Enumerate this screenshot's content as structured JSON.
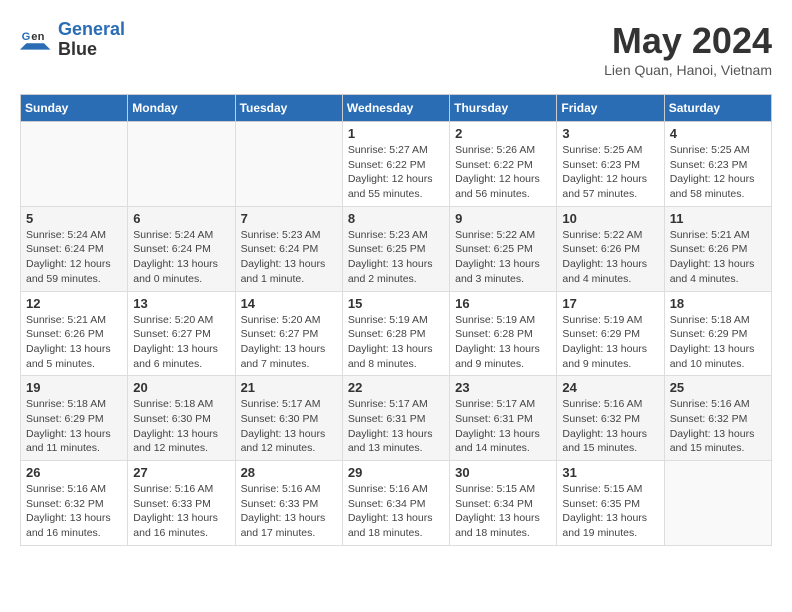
{
  "header": {
    "logo_line1": "General",
    "logo_line2": "Blue",
    "month_title": "May 2024",
    "location": "Lien Quan, Hanoi, Vietnam"
  },
  "days_of_week": [
    "Sunday",
    "Monday",
    "Tuesday",
    "Wednesday",
    "Thursday",
    "Friday",
    "Saturday"
  ],
  "weeks": [
    [
      {
        "day": "",
        "info": ""
      },
      {
        "day": "",
        "info": ""
      },
      {
        "day": "",
        "info": ""
      },
      {
        "day": "1",
        "info": "Sunrise: 5:27 AM\nSunset: 6:22 PM\nDaylight: 12 hours and 55 minutes."
      },
      {
        "day": "2",
        "info": "Sunrise: 5:26 AM\nSunset: 6:22 PM\nDaylight: 12 hours and 56 minutes."
      },
      {
        "day": "3",
        "info": "Sunrise: 5:25 AM\nSunset: 6:23 PM\nDaylight: 12 hours and 57 minutes."
      },
      {
        "day": "4",
        "info": "Sunrise: 5:25 AM\nSunset: 6:23 PM\nDaylight: 12 hours and 58 minutes."
      }
    ],
    [
      {
        "day": "5",
        "info": "Sunrise: 5:24 AM\nSunset: 6:24 PM\nDaylight: 12 hours and 59 minutes."
      },
      {
        "day": "6",
        "info": "Sunrise: 5:24 AM\nSunset: 6:24 PM\nDaylight: 13 hours and 0 minutes."
      },
      {
        "day": "7",
        "info": "Sunrise: 5:23 AM\nSunset: 6:24 PM\nDaylight: 13 hours and 1 minute."
      },
      {
        "day": "8",
        "info": "Sunrise: 5:23 AM\nSunset: 6:25 PM\nDaylight: 13 hours and 2 minutes."
      },
      {
        "day": "9",
        "info": "Sunrise: 5:22 AM\nSunset: 6:25 PM\nDaylight: 13 hours and 3 minutes."
      },
      {
        "day": "10",
        "info": "Sunrise: 5:22 AM\nSunset: 6:26 PM\nDaylight: 13 hours and 4 minutes."
      },
      {
        "day": "11",
        "info": "Sunrise: 5:21 AM\nSunset: 6:26 PM\nDaylight: 13 hours and 4 minutes."
      }
    ],
    [
      {
        "day": "12",
        "info": "Sunrise: 5:21 AM\nSunset: 6:26 PM\nDaylight: 13 hours and 5 minutes."
      },
      {
        "day": "13",
        "info": "Sunrise: 5:20 AM\nSunset: 6:27 PM\nDaylight: 13 hours and 6 minutes."
      },
      {
        "day": "14",
        "info": "Sunrise: 5:20 AM\nSunset: 6:27 PM\nDaylight: 13 hours and 7 minutes."
      },
      {
        "day": "15",
        "info": "Sunrise: 5:19 AM\nSunset: 6:28 PM\nDaylight: 13 hours and 8 minutes."
      },
      {
        "day": "16",
        "info": "Sunrise: 5:19 AM\nSunset: 6:28 PM\nDaylight: 13 hours and 9 minutes."
      },
      {
        "day": "17",
        "info": "Sunrise: 5:19 AM\nSunset: 6:29 PM\nDaylight: 13 hours and 9 minutes."
      },
      {
        "day": "18",
        "info": "Sunrise: 5:18 AM\nSunset: 6:29 PM\nDaylight: 13 hours and 10 minutes."
      }
    ],
    [
      {
        "day": "19",
        "info": "Sunrise: 5:18 AM\nSunset: 6:29 PM\nDaylight: 13 hours and 11 minutes."
      },
      {
        "day": "20",
        "info": "Sunrise: 5:18 AM\nSunset: 6:30 PM\nDaylight: 13 hours and 12 minutes."
      },
      {
        "day": "21",
        "info": "Sunrise: 5:17 AM\nSunset: 6:30 PM\nDaylight: 13 hours and 12 minutes."
      },
      {
        "day": "22",
        "info": "Sunrise: 5:17 AM\nSunset: 6:31 PM\nDaylight: 13 hours and 13 minutes."
      },
      {
        "day": "23",
        "info": "Sunrise: 5:17 AM\nSunset: 6:31 PM\nDaylight: 13 hours and 14 minutes."
      },
      {
        "day": "24",
        "info": "Sunrise: 5:16 AM\nSunset: 6:32 PM\nDaylight: 13 hours and 15 minutes."
      },
      {
        "day": "25",
        "info": "Sunrise: 5:16 AM\nSunset: 6:32 PM\nDaylight: 13 hours and 15 minutes."
      }
    ],
    [
      {
        "day": "26",
        "info": "Sunrise: 5:16 AM\nSunset: 6:32 PM\nDaylight: 13 hours and 16 minutes."
      },
      {
        "day": "27",
        "info": "Sunrise: 5:16 AM\nSunset: 6:33 PM\nDaylight: 13 hours and 16 minutes."
      },
      {
        "day": "28",
        "info": "Sunrise: 5:16 AM\nSunset: 6:33 PM\nDaylight: 13 hours and 17 minutes."
      },
      {
        "day": "29",
        "info": "Sunrise: 5:16 AM\nSunset: 6:34 PM\nDaylight: 13 hours and 18 minutes."
      },
      {
        "day": "30",
        "info": "Sunrise: 5:15 AM\nSunset: 6:34 PM\nDaylight: 13 hours and 18 minutes."
      },
      {
        "day": "31",
        "info": "Sunrise: 5:15 AM\nSunset: 6:35 PM\nDaylight: 13 hours and 19 minutes."
      },
      {
        "day": "",
        "info": ""
      }
    ]
  ]
}
